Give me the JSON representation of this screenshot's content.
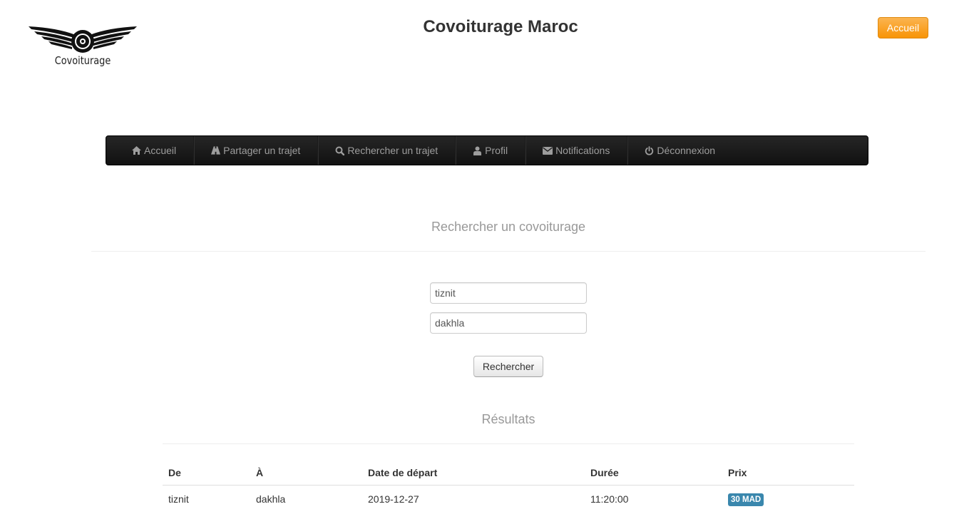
{
  "logo": {
    "text": "Covoiturage"
  },
  "header": {
    "site_title": "Covoiturage Maroc",
    "home_button": "Accueil",
    "home_button_color": "#f89406"
  },
  "nav": {
    "items": [
      {
        "label": "Accueil",
        "icon": "home-icon"
      },
      {
        "label": "Partager un trajet",
        "icon": "road-icon"
      },
      {
        "label": "Rechercher un trajet",
        "icon": "search-icon"
      },
      {
        "label": "Profil",
        "icon": "user-icon"
      },
      {
        "label": "Notifications",
        "icon": "envelope-icon"
      },
      {
        "label": "Déconnexion",
        "icon": "power-icon"
      }
    ]
  },
  "search": {
    "title": "Rechercher un covoiturage",
    "from_value": "tiznit",
    "to_value": "dakhla",
    "submit_label": "Rechercher"
  },
  "results": {
    "title": "Résultats",
    "columns": [
      "De",
      "À",
      "Date de départ",
      "Durée",
      "Prix"
    ],
    "rows": [
      {
        "from": "tiznit",
        "to": "dakhla",
        "date": "2019-12-27",
        "duration": "11:20:00",
        "price": "30 MAD"
      }
    ]
  },
  "colors": {
    "navbar": "#1b1b1b",
    "nav_text": "#9d9d9d",
    "price_badge": "#3a87ad"
  }
}
